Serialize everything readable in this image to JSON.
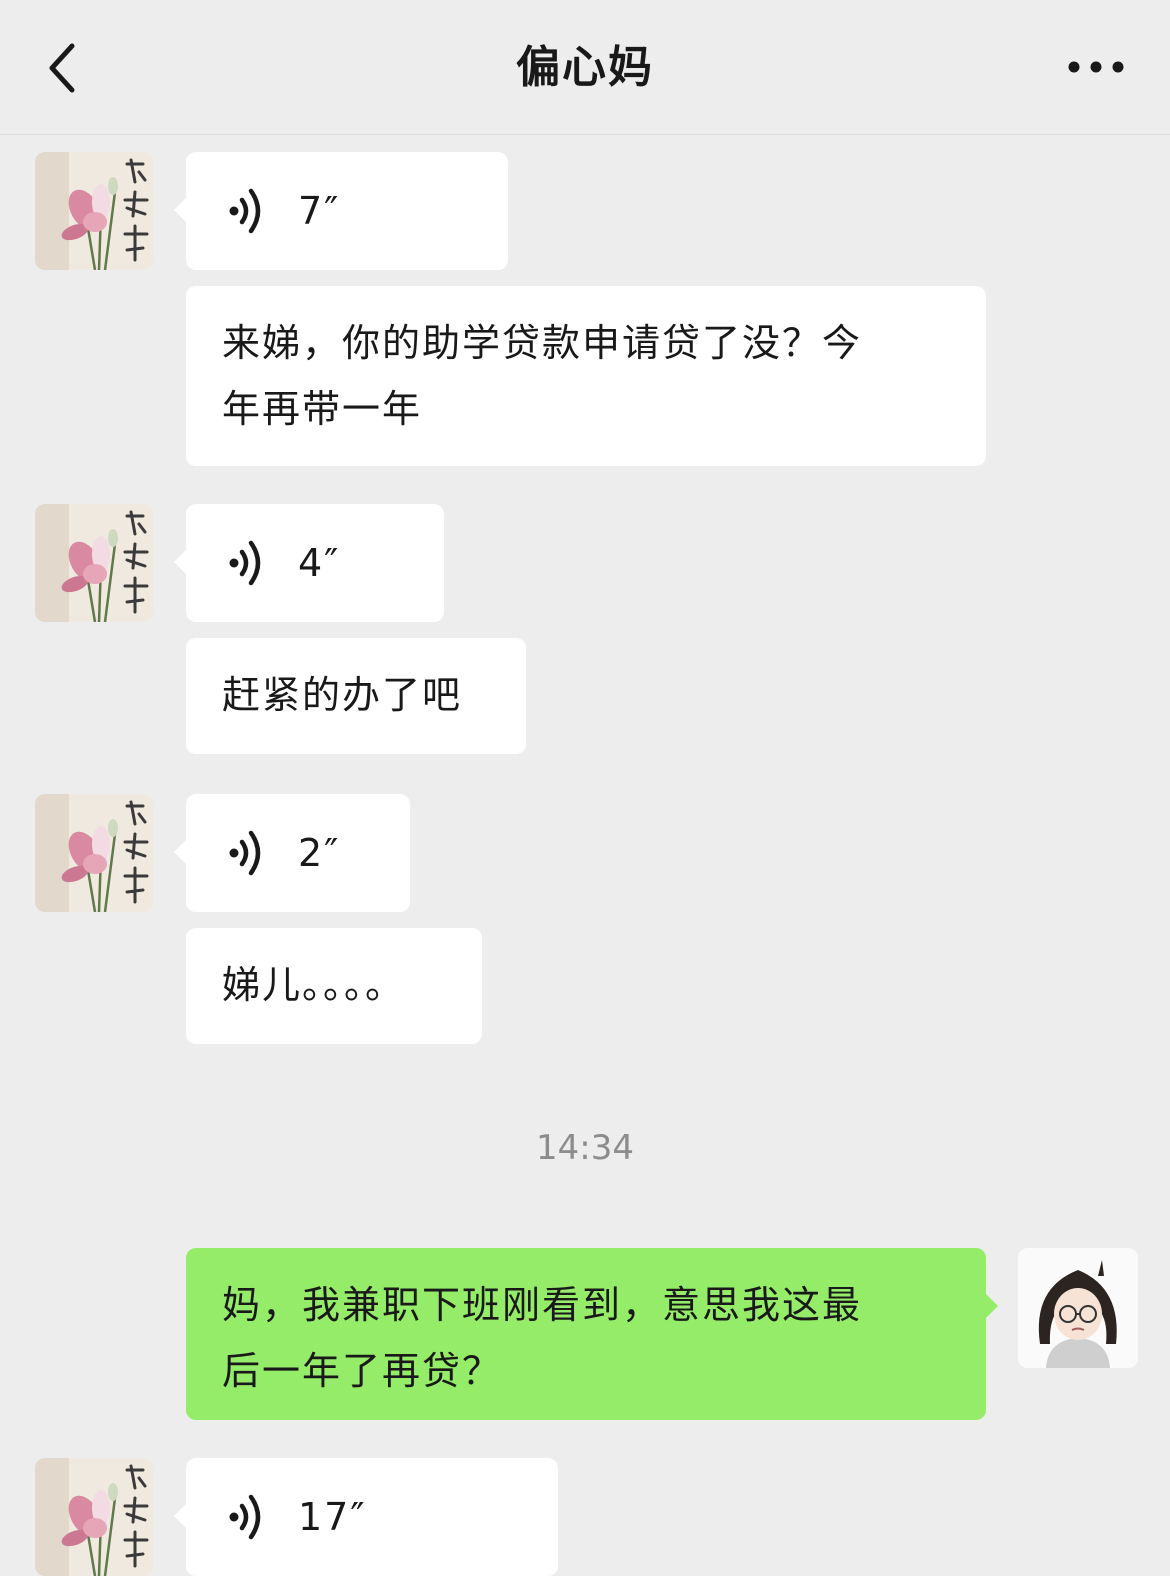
{
  "header": {
    "title": "偏心妈"
  },
  "messages": [
    {
      "type": "voice",
      "duration": "7″"
    },
    {
      "type": "text",
      "line1": "来娣，你的助学贷款申请贷了没？今",
      "line2": "年再带一年"
    },
    {
      "type": "voice",
      "duration": "4″"
    },
    {
      "type": "text",
      "line1": "赶紧的办了吧"
    },
    {
      "type": "voice",
      "duration": "2″"
    },
    {
      "type": "text",
      "line1": "娣儿。。。。"
    },
    {
      "type": "time",
      "text": "14:34"
    },
    {
      "type": "text",
      "line1": "妈，我兼职下班刚看到，意思我这最",
      "line2": "后一年了再贷？"
    },
    {
      "type": "voice",
      "duration": "17″"
    }
  ],
  "colors": {
    "background": "#ededed",
    "bubble_other": "#ffffff",
    "bubble_self": "#95ec69"
  },
  "icons": [
    "back-arrow-icon",
    "more-dots-icon",
    "voice-wave-icon"
  ]
}
